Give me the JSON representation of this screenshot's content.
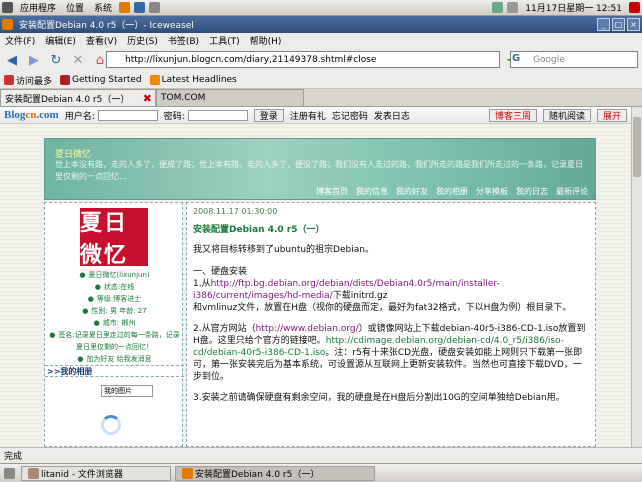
{
  "top_panel": {
    "menus": [
      "应用程序",
      "位置",
      "系统"
    ],
    "clock": "11月17日星期一 12:51"
  },
  "window": {
    "title": "安装配置Debian 4.0 r5（一）- Iceweasel",
    "buttons": [
      "_",
      "□",
      "×"
    ]
  },
  "menubar": [
    "文件(F)",
    "编辑(E)",
    "查看(V)",
    "历史(S)",
    "书签(B)",
    "工具(T)",
    "帮助(H)"
  ],
  "navbar": {
    "url": "http://lixunjun.blogcn.com/diary,21149378.shtml#close",
    "search_placeholder": "Google"
  },
  "bookmarks": [
    "访问最多",
    "Getting Started",
    "Latest Headlines"
  ],
  "tabs": [
    {
      "label": "安装配置Debian 4.0 r5（一）",
      "active": true
    },
    {
      "label": "TOM.COM",
      "active": false
    }
  ],
  "blogbar": {
    "logo_main": "Blog",
    "logo_accent": "cn",
    "logo_suffix": ".com",
    "user_label": "用户名:",
    "pass_label": "密码:",
    "login": "登录",
    "register": "注册有礼",
    "forgot": "忘记密码",
    "post": "发表日志",
    "right_buttons": [
      "博客三周",
      "随机阅读",
      "展开"
    ]
  },
  "banner": {
    "title": "夏日微忆",
    "slogan": "世上本没有路，走的人多了，便成了路；世上本有路，走的人多了，便没了路；我们没有人走过的路，我们所走的路是我们所走过的一条路，记录夏日里仅剩的一点回忆…",
    "nav": [
      "博客首页",
      "我的信息",
      "我的好友",
      "我的相册",
      "分享模板",
      "我的日志",
      "最新评论"
    ]
  },
  "sidebar": {
    "seal_text": "夏日微忆",
    "info": [
      "夏日微忆(lixunjun)",
      "状态:在线",
      "等级:博客进士",
      "性别: 男 年龄: 27",
      "城市: 郴州",
      "签名:记录夏日里走过的每一条路，记录",
      "夏日里仅剩的一点回忆！",
      "加为好友   给我发消息"
    ],
    "album_heading": ">>我的相册",
    "album_select": "我的图片"
  },
  "post": {
    "date": "2008.11.17 01:30:00",
    "title": "安装配置Debian 4.0 r5（一）",
    "intro": "我又将目标转移到了ubuntu的祖宗Debian。",
    "s1_head": "一、硬盘安装",
    "s1_prefix": "1.从",
    "s1_link": "http://ftp.bg.debian.org/debian/dists/Debian4.0r5/main/installer-i386/current/images/hd-media/",
    "s1_suffix": "下载initrd.gz",
    "s1_line2": "和vmlinuz文件，放置在H盘（视你的硬盘而定，最好为fat32格式，下以H盘为例）根目录下。",
    "s2_prefix": "2.从官方网站（",
    "s2_link": "http://www.debian.org/",
    "s2_mid": "）或镜像网站上下载debian-40r5-i386-CD-1.iso放置到H盘。这里只给个官方的链接吧。",
    "s2_link2": "http://cdimage.debian.org/debian-cd/4.0_r5/i386/iso-cd/debian-40r5-i386-CD-1.iso",
    "s2_suffix": "。注：r5有十来张CD光盘，硬盘安装如能上网则只下载第一张即可，第一张安装完后为基本系统，可设置源从互联网上更新安装软件。当然也可直接下载DVD，一步到位。",
    "s3": "3.安装之前请确保硬盘有剩余空间，我的硬盘是在H盘后分割出10G的空间单独给Debian用。"
  },
  "statusbar": {
    "text": "完成"
  },
  "taskbar": [
    {
      "label": "litanid - 文件浏览器",
      "active": false
    },
    {
      "label": "安装配置Debian 4.0 r5（一）",
      "active": true
    }
  ],
  "colors": {
    "accent": "#2c4e7c",
    "banner": "#7ec1ae",
    "seal": "#c8102e",
    "post_title": "#1a7a3a"
  }
}
